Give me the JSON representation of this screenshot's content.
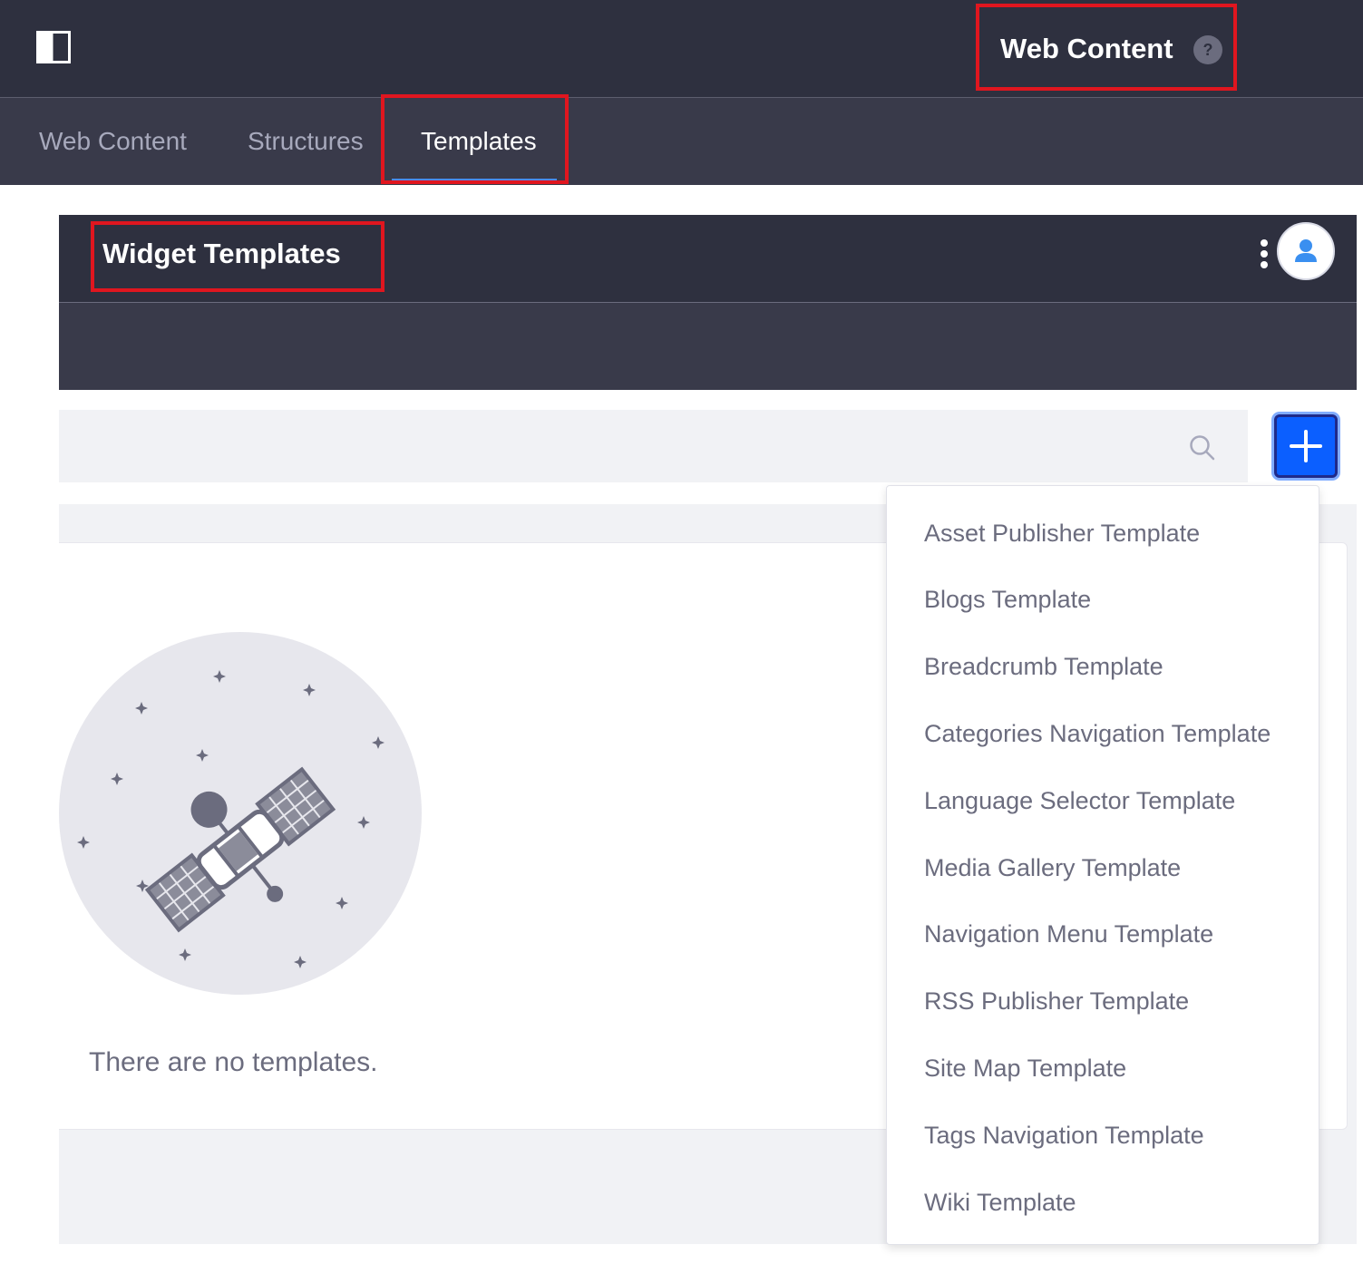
{
  "app_bar": {
    "title": "Web Content",
    "help": "?",
    "icons": {
      "panel_toggle": "panel-toggle-icon",
      "help": "question-circle-icon"
    }
  },
  "tabs": [
    {
      "label": "Web Content",
      "active": false
    },
    {
      "label": "Structures",
      "active": false
    },
    {
      "label": "Templates",
      "active": true
    }
  ],
  "widget_templates": {
    "title": "Widget Templates",
    "icons": {
      "options": "ellipsis-v-icon",
      "user": "user-avatar-icon"
    }
  },
  "search": {
    "placeholder": "",
    "value": "",
    "icon": "search-icon"
  },
  "add_button": {
    "icon": "plus-icon",
    "accent": "#0b5fff"
  },
  "add_menu": {
    "items": [
      "Asset Publisher Template",
      "Blogs Template",
      "Breadcrumb Template",
      "Categories Navigation Template",
      "Language Selector Template",
      "Media Gallery Template",
      "Navigation Menu Template",
      "RSS Publisher Template",
      "Site Map Template",
      "Tags Navigation Template",
      "Wiki Template"
    ]
  },
  "empty_state": {
    "message": "There are no templates.",
    "illustration": "satellite-illustration"
  },
  "colors": {
    "header_dark": "#2e303f",
    "tab_bar": "#393a4a",
    "highlight_box": "#e0161f",
    "accent": "#0b5fff"
  }
}
